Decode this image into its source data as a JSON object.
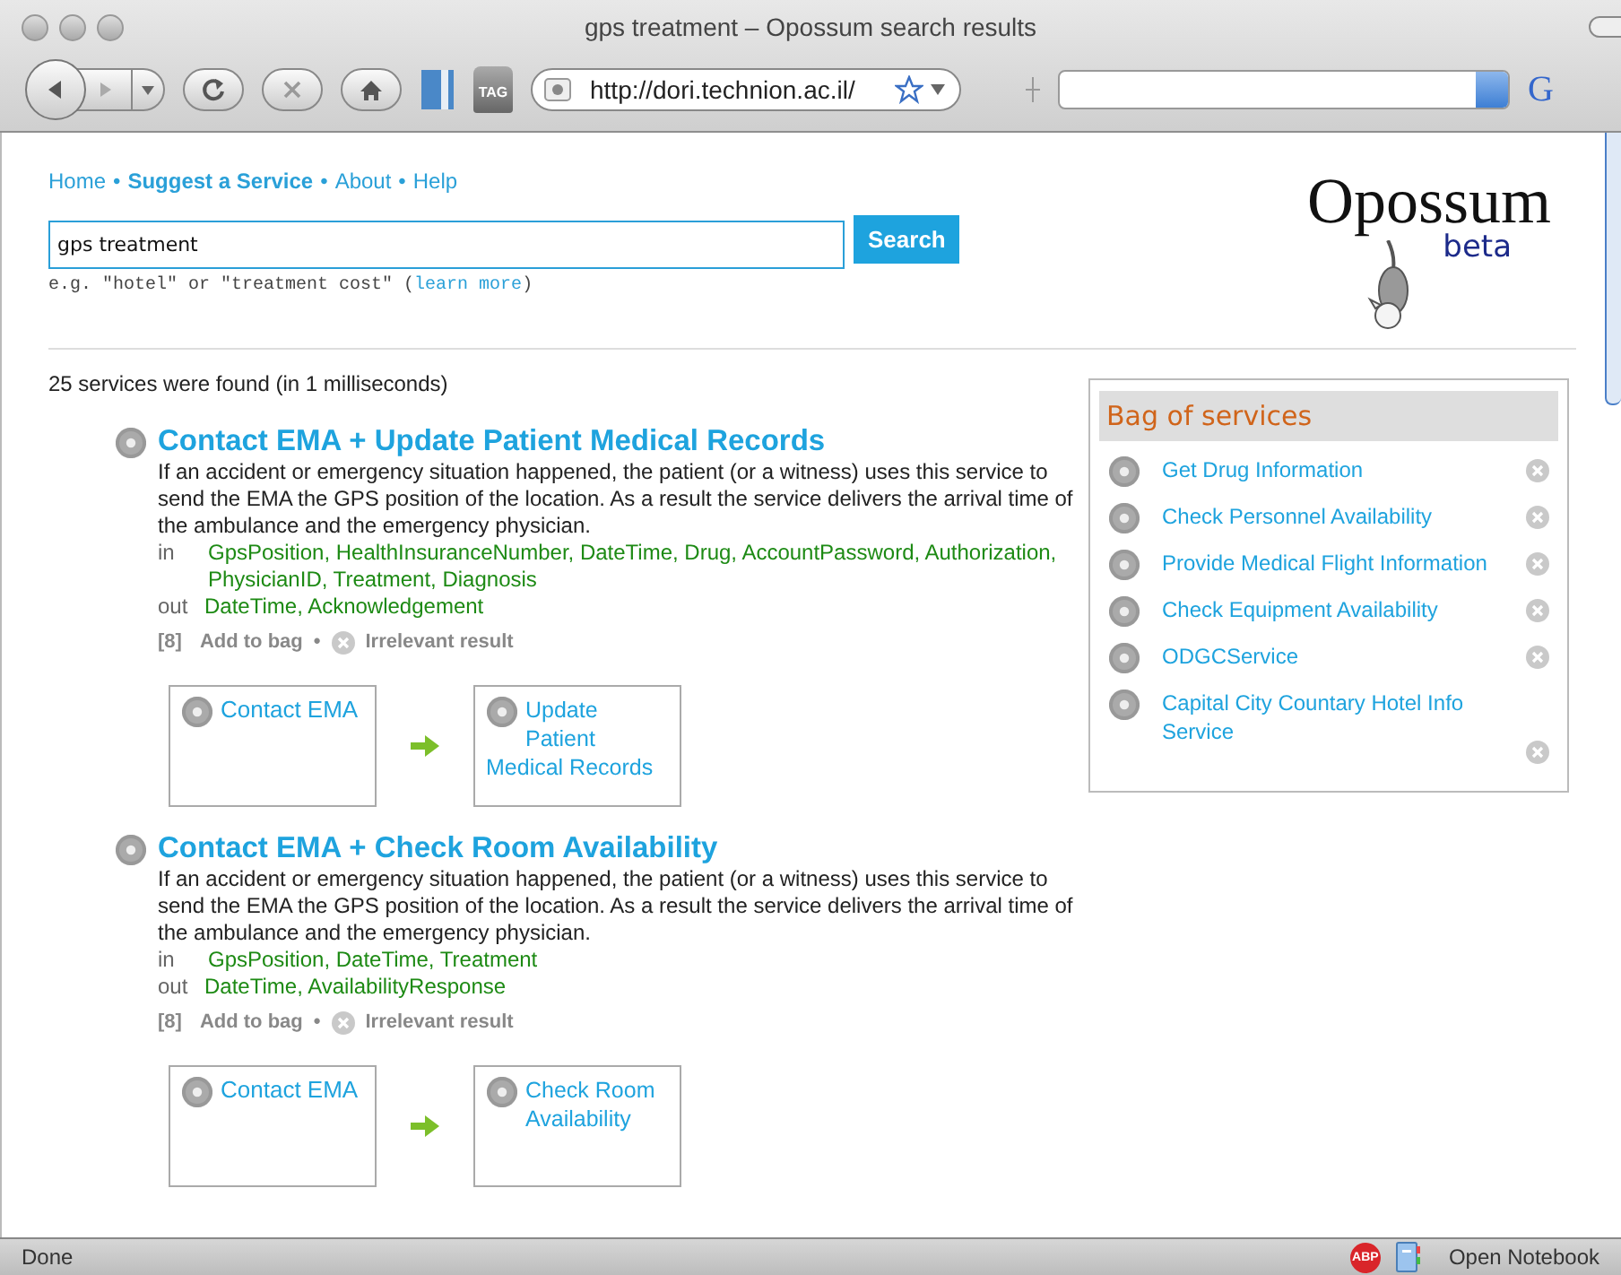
{
  "window": {
    "title": "gps treatment – Opossum search results"
  },
  "toolbar": {
    "tag_label": "TAG",
    "url": "http://dori.technion.ac.il/",
    "engine_label": "G"
  },
  "nav_separator": "•",
  "nav": [
    {
      "label": "Home",
      "bold": false
    },
    {
      "label": "Suggest a Service",
      "bold": true
    },
    {
      "label": "About",
      "bold": false
    },
    {
      "label": "Help",
      "bold": false
    }
  ],
  "search": {
    "value": "gps treatment",
    "button": "Search",
    "hint_before": "e.g. \"hotel\" or \"treatment cost\" (",
    "hint_link": "learn more",
    "hint_after": ")"
  },
  "logo": {
    "name": "Opossum",
    "tag": "beta"
  },
  "result_count": "25 services were found (in 1 milliseconds)",
  "results": [
    {
      "title": "Contact EMA + Update Patient Medical Records",
      "description": "If an accident or emergency situation happened, the patient (or a witness) uses this service to send the EMA the GPS position of the location. As a result the service delivers the arrival time of the ambulance and the emergency physician.",
      "in_label": "in",
      "inputs": "GpsPosition, HealthInsuranceNumber, DateTime, Drug, AccountPassword, Authorization, PhysicianID, Treatment, Diagnosis",
      "out_label": "out",
      "outputs": "DateTime, Acknowledgement",
      "rank": "[8]",
      "add": "Add to bag",
      "separator": "•",
      "irrelevant": "Irrelevant result",
      "chain": [
        "Contact EMA",
        "Update Patient Medical Records"
      ]
    },
    {
      "title": "Contact EMA + Check Room Availability",
      "description": "If an accident or emergency situation happened, the patient (or a witness) uses this service to send the EMA the GPS position of the location. As a result the service delivers the arrival time of the ambulance and the emergency physician.",
      "in_label": "in",
      "inputs": "GpsPosition, DateTime, Treatment",
      "out_label": "out",
      "outputs": "DateTime, AvailabilityResponse",
      "rank": "[8]",
      "add": "Add to bag",
      "separator": "•",
      "irrelevant": "Irrelevant result",
      "chain": [
        "Contact EMA",
        "Check Room Availability"
      ]
    }
  ],
  "bag": {
    "title": "Bag of services",
    "items": [
      "Get Drug Information",
      "Check Personnel Availability",
      "Provide Medical Flight Information",
      "Check Equipment Availability",
      "ODGCService",
      "Capital City Countary Hotel Info Service"
    ]
  },
  "status_bar": {
    "text": "Done",
    "adblock_label": "ABP",
    "notebook": "Open Notebook"
  }
}
